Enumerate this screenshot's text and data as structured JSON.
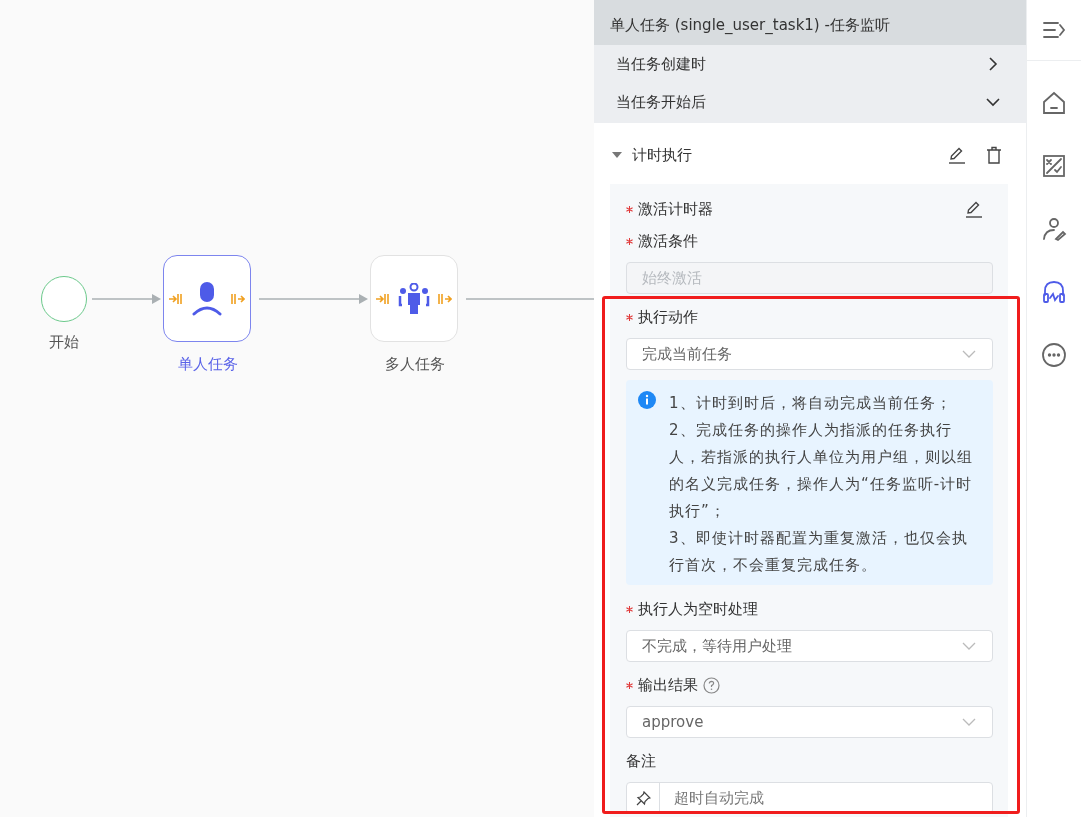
{
  "canvas": {
    "nodes": [
      {
        "kind": "start",
        "label": "开始",
        "selected": false
      },
      {
        "kind": "user",
        "label": "单人任务",
        "selected": true
      },
      {
        "kind": "multi",
        "label": "多人任务",
        "selected": false
      }
    ]
  },
  "panel": {
    "title": "单人任务 (single_user_task1) -任务监听",
    "triggers": [
      {
        "label": "当任务创建时",
        "expanded": false
      },
      {
        "label": "当任务开始后",
        "expanded": true
      }
    ],
    "section": {
      "title": "计时执行",
      "expanded": true,
      "fields": [
        {
          "kind": "action",
          "label": "激活计时器",
          "required": true
        },
        {
          "kind": "input",
          "label": "激活条件",
          "required": true,
          "placeholder": "始终激活",
          "disabled": true
        },
        {
          "kind": "select",
          "label": "执行动作",
          "required": true,
          "value": "完成当前任务"
        },
        {
          "kind": "info",
          "lines": [
            "1、计时到时后，将自动完成当前任务；",
            "2、完成任务的操作人为指派的任务执行人，若指派的执行人单位为用户组，则以组的名义完成任务，操作人为“任务监听-计时执行”；",
            "3、即使计时器配置为重复激活，也仅会执行首次，不会重复完成任务。"
          ]
        },
        {
          "kind": "select",
          "label": "执行人为空时处理",
          "required": true,
          "value": "不完成，等待用户处理"
        },
        {
          "kind": "select",
          "label": "输出结果",
          "required": true,
          "help": true,
          "value": "approve"
        },
        {
          "kind": "pin-input",
          "label": "备注",
          "required": false,
          "value": "超时自动完成"
        }
      ]
    }
  },
  "sidebar": {
    "items": [
      {
        "kind": "collapse",
        "selected": false
      },
      {
        "kind": "home",
        "selected": false
      },
      {
        "kind": "formula",
        "selected": false
      },
      {
        "kind": "user-edit",
        "selected": false
      },
      {
        "kind": "listener",
        "selected": true
      },
      {
        "kind": "more",
        "selected": false
      }
    ]
  }
}
